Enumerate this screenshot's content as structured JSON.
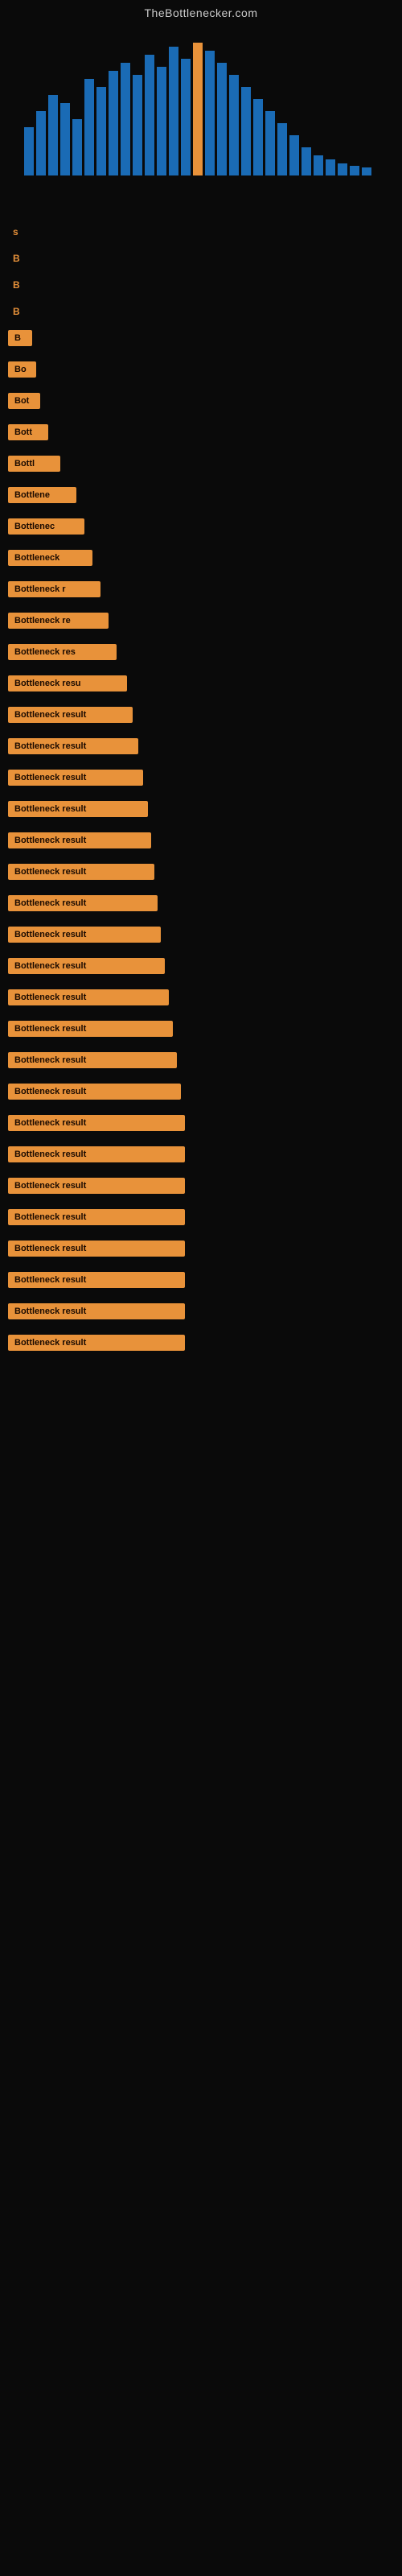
{
  "site": {
    "title": "TheBottlenecker.com"
  },
  "results": {
    "label": "Bottleneck result",
    "items": [
      {
        "width_class": "w-30",
        "label": "B"
      },
      {
        "width_class": "w-35",
        "label": "Bo"
      },
      {
        "width_class": "w-40",
        "label": "Bot"
      },
      {
        "width_class": "w-50",
        "label": "Bott"
      },
      {
        "width_class": "w-60",
        "label": "Bottl"
      },
      {
        "width_class": "w-80",
        "label": "Bottlene"
      },
      {
        "width_class": "w-90",
        "label": "Bottlenec"
      },
      {
        "width_class": "w-100",
        "label": "Bottleneck"
      },
      {
        "width_class": "w-110",
        "label": "Bottleneck r"
      },
      {
        "width_class": "w-120",
        "label": "Bottleneck re"
      },
      {
        "width_class": "w-130",
        "label": "Bottleneck res"
      },
      {
        "width_class": "w-140",
        "label": "Bottleneck resu"
      },
      {
        "width_class": "w-150",
        "label": "Bottleneck result"
      },
      {
        "width_class": "w-160",
        "label": "Bottleneck result"
      },
      {
        "width_class": "w-165",
        "label": "Bottleneck result"
      },
      {
        "width_class": "w-170",
        "label": "Bottleneck result"
      },
      {
        "width_class": "w-175",
        "label": "Bottleneck result"
      },
      {
        "width_class": "w-180",
        "label": "Bottleneck result"
      },
      {
        "width_class": "w-185",
        "label": "Bottleneck result"
      },
      {
        "width_class": "w-190",
        "label": "Bottleneck result"
      },
      {
        "width_class": "w-195",
        "label": "Bottleneck result"
      },
      {
        "width_class": "w-200",
        "label": "Bottleneck result"
      },
      {
        "width_class": "w-205",
        "label": "Bottleneck result"
      },
      {
        "width_class": "w-210",
        "label": "Bottleneck result"
      },
      {
        "width_class": "w-215",
        "label": "Bottleneck result"
      },
      {
        "width_class": "w-220",
        "label": "Bottleneck result"
      },
      {
        "width_class": "w-220",
        "label": "Bottleneck result"
      },
      {
        "width_class": "w-220",
        "label": "Bottleneck result"
      },
      {
        "width_class": "w-220",
        "label": "Bottleneck result"
      },
      {
        "width_class": "w-220",
        "label": "Bottleneck result"
      },
      {
        "width_class": "w-220",
        "label": "Bottleneck result"
      },
      {
        "width_class": "w-220",
        "label": "Bottleneck result"
      },
      {
        "width_class": "w-220",
        "label": "Bottleneck result"
      }
    ]
  },
  "early_labels": [
    {
      "width_class": "w-30",
      "text": "s"
    },
    {
      "width_class": "w-35",
      "text": "B"
    },
    {
      "width_class": "w-40",
      "text": "Bo"
    },
    {
      "width_class": "w-50",
      "text": "Bot"
    }
  ]
}
